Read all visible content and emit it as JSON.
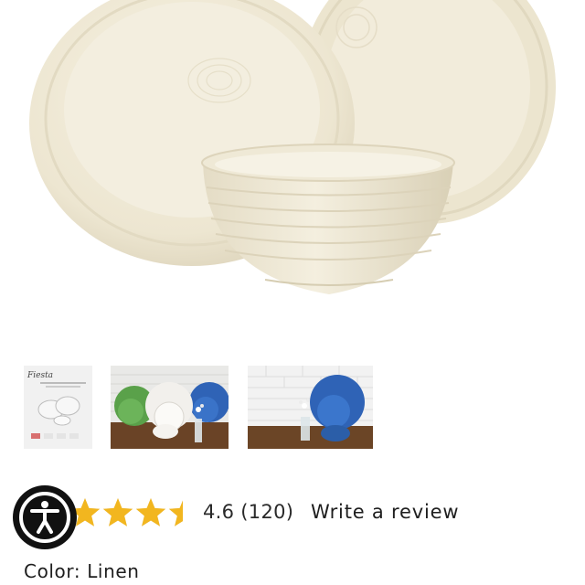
{
  "product": {
    "image_alt_icon": "dinnerware-photo",
    "thumbnails": [
      {
        "name": "thumbnail-dimensions-card",
        "brand_text": "Fiesta"
      },
      {
        "name": "thumbnail-green-white-blue-sets"
      },
      {
        "name": "thumbnail-blue-set"
      }
    ]
  },
  "rating": {
    "value": "4.6",
    "count": "(120)",
    "stars_value": 4.6,
    "star_color": "#f2b61f",
    "review_link": "Write a review"
  },
  "color": {
    "label": "Color:",
    "value": "Linen"
  },
  "accessibility": {
    "icon": "accessibility-person-icon"
  }
}
